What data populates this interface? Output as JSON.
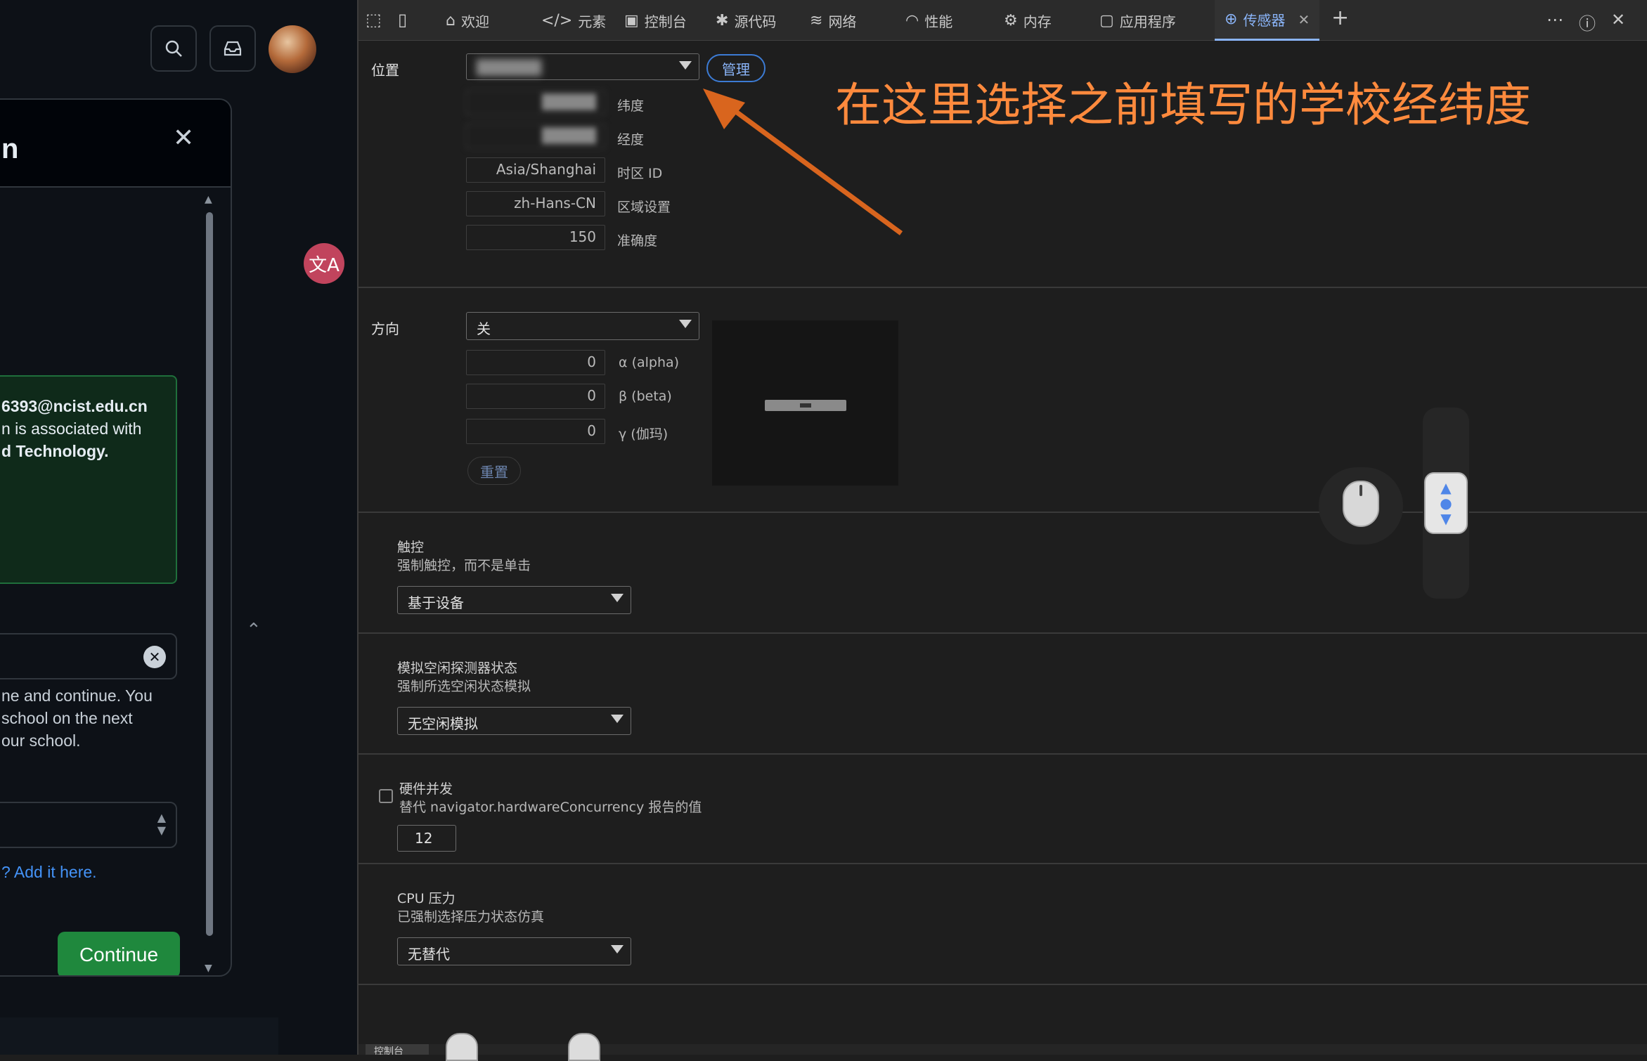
{
  "left_app": {
    "dialog_title": "n",
    "email_line": "6393@ncist.edu.cn",
    "assoc_line1": "n is associated with",
    "assoc_line2": "d Technology.",
    "help_line1": "ne and continue. You",
    "help_line2": "school on the next",
    "help_line3": "our school.",
    "add_link": "? Add it here.",
    "continue_label": "Continue"
  },
  "devtools": {
    "tabs": [
      {
        "label": "欢迎",
        "icon": "home-icon"
      },
      {
        "label": "元素",
        "icon": "code-icon"
      },
      {
        "label": "控制台",
        "icon": "console-icon"
      },
      {
        "label": "源代码",
        "icon": "bug-icon"
      },
      {
        "label": "网络",
        "icon": "wifi-icon"
      },
      {
        "label": "性能",
        "icon": "gauge-icon"
      },
      {
        "label": "内存",
        "icon": "memory-icon"
      },
      {
        "label": "应用程序",
        "icon": "window-icon"
      },
      {
        "label": "传感器",
        "icon": "sensor-icon",
        "active": true
      }
    ],
    "location": {
      "label": "位置",
      "manage_label": "管理",
      "latitude_label": "纬度",
      "longitude_label": "经度",
      "timezone_value": "Asia/Shanghai",
      "timezone_label": "时区 ID",
      "locale_value": "zh-Hans-CN",
      "locale_label": "区域设置",
      "accuracy_value": "150",
      "accuracy_label": "准确度"
    },
    "orientation": {
      "label": "方向",
      "select_value": "关",
      "alpha_value": "0",
      "alpha_label": "α (alpha)",
      "beta_value": "0",
      "beta_label": "β (beta)",
      "gamma_value": "0",
      "gamma_label": "γ (伽玛)",
      "reset_label": "重置"
    },
    "touch": {
      "title": "触控",
      "desc": "强制触控，而不是单击",
      "select_value": "基于设备"
    },
    "idle": {
      "title": "模拟空闲探测器状态",
      "desc": "强制所选空闲状态模拟",
      "select_value": "无空闲模拟"
    },
    "hardware": {
      "title": "硬件并发",
      "desc": "替代 navigator.hardwareConcurrency 报告的值",
      "value": "12"
    },
    "cpu": {
      "title": "CPU 压力",
      "desc": "已强制选择压力状态仿真",
      "select_value": "无替代"
    },
    "bottom_tab": "控制台"
  },
  "annotation": "在这里选择之前填写的学校经纬度",
  "colors": {
    "accent": "#8ab4f8",
    "annotation": "#ff8a3d",
    "continue_green": "#1f883d"
  }
}
